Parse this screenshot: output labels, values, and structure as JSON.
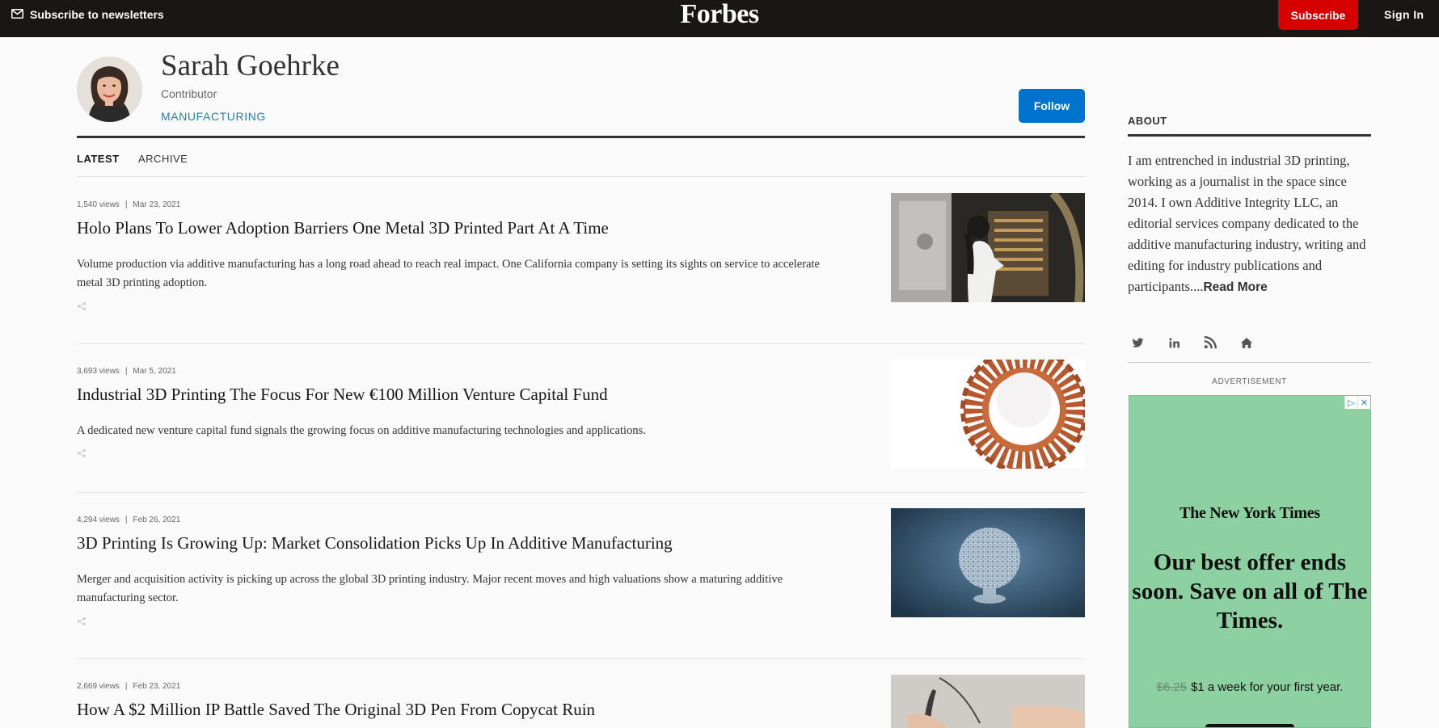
{
  "topbar": {
    "newsletter_label": "Subscribe to newsletters",
    "logo": "Forbes",
    "subscribe_label": "Subscribe",
    "signin_label": "Sign In"
  },
  "author": {
    "name": "Sarah Goehrke",
    "role": "Contributor",
    "topic": "MANUFACTURING",
    "follow_label": "Follow"
  },
  "tabs": [
    {
      "label": "LATEST",
      "active": true
    },
    {
      "label": "ARCHIVE",
      "active": false
    }
  ],
  "articles": [
    {
      "views": "1,540 views",
      "date": "Mar 23, 2021",
      "title": "Holo Plans To Lower Adoption Barriers One Metal 3D Printed Part At A Time",
      "description": "Volume production via additive manufacturing has a long road ahead to reach real impact. One California company is setting its sights on service to accelerate metal 3D printing adoption."
    },
    {
      "views": "3,693 views",
      "date": "Mar 5, 2021",
      "title": "Industrial 3D Printing The Focus For New €100 Million Venture Capital Fund",
      "description": "A dedicated new venture capital fund signals the growing focus on additive manufacturing technologies and applications."
    },
    {
      "views": "4,294 views",
      "date": "Feb 26, 2021",
      "title": "3D Printing Is Growing Up: Market Consolidation Picks Up In Additive Manufacturing",
      "description": "Merger and acquisition activity is picking up across the global 3D printing industry. Major recent moves and high valuations show a maturing additive manufacturing sector."
    },
    {
      "views": "2,669 views",
      "date": "Feb 23, 2021",
      "title": "How A $2 Million IP Battle Saved The Original 3D Pen From Copycat Ruin",
      "description": ""
    }
  ],
  "sidebar": {
    "about_heading": "ABOUT",
    "about_text": "I am entrenched in industrial 3D printing, working as a journalist in the space since 2014. I own Additive Integrity LLC, an editorial services company dedicated to the additive manufacturing industry, writing and editing for industry publications and participants....",
    "read_more_label": "Read More",
    "social_icons": [
      "twitter-icon",
      "linkedin-icon",
      "rss-icon",
      "home-icon"
    ],
    "advertisement_label": "ADVERTISEMENT"
  },
  "ad": {
    "brand": "The New York Times",
    "headline": "Our best offer ends soon. Save on all of The Times.",
    "old_price": "$6.25",
    "offer": "$1 a week for your first year."
  },
  "colors": {
    "topbar_bg": "#181716",
    "subscribe_red": "#d70000",
    "follow_blue": "#0073cf",
    "topic_teal": "#2a7f9e",
    "ad_green": "#8dd0a2"
  }
}
